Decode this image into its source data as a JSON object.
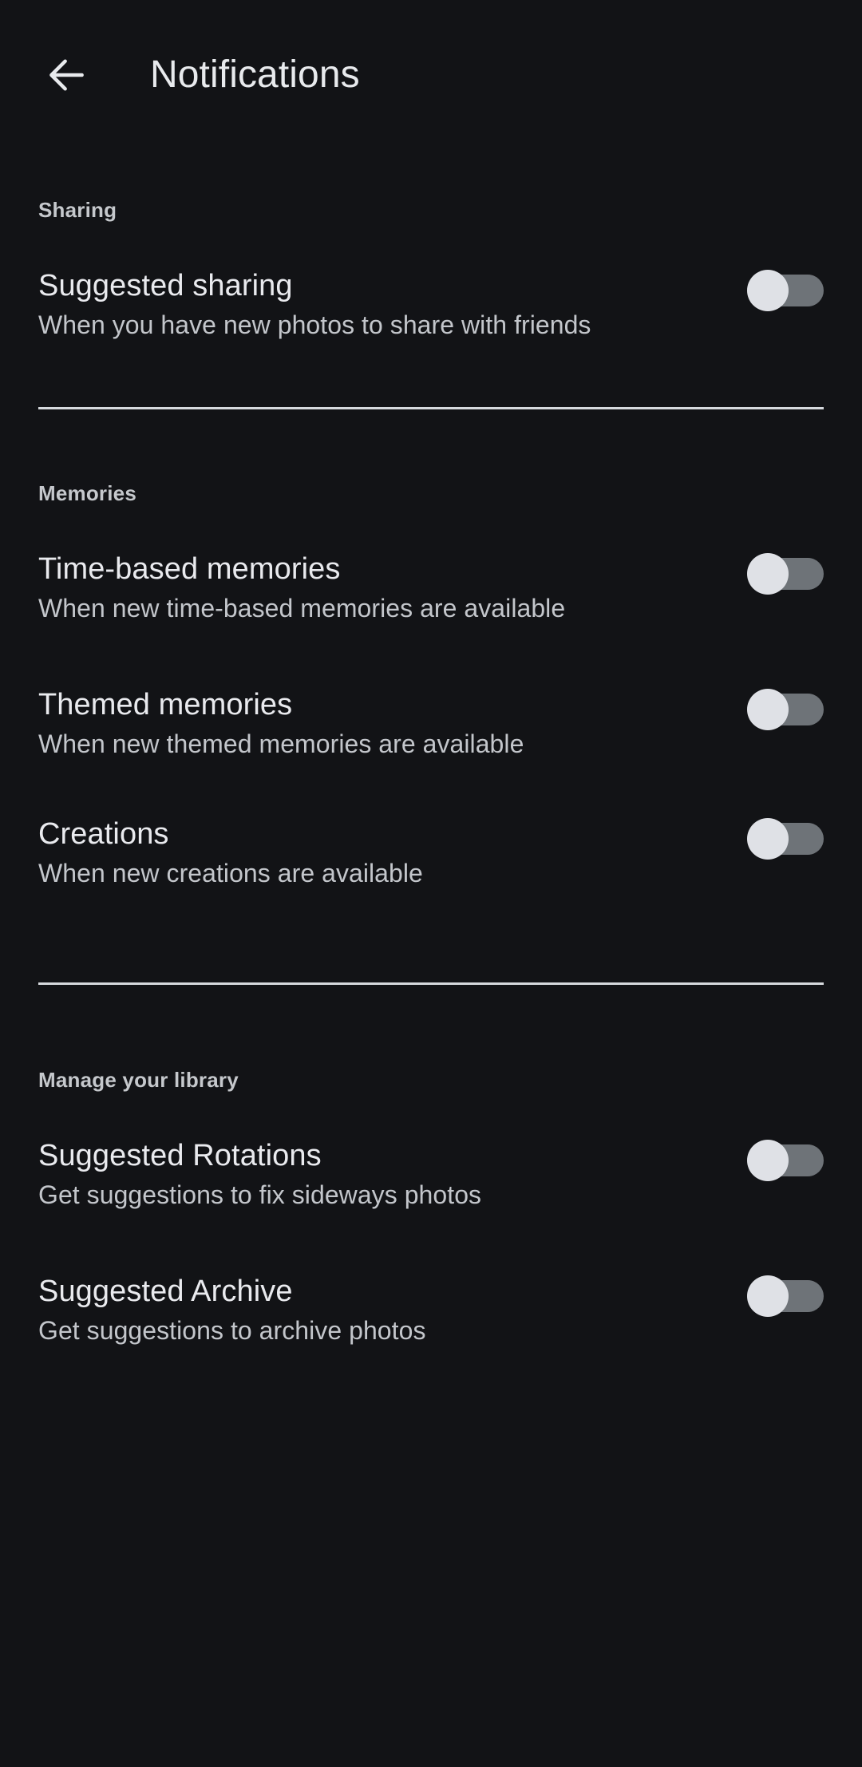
{
  "app": {
    "screen_title": "Notifications",
    "background_color": "#121316",
    "accent_text_color": "#e8eaed",
    "secondary_text_color": "#c3c6cb",
    "divider_color": "#d6d9dd",
    "toggle_track_color": "#6e7378",
    "toggle_thumb_color": "#dfe1e6"
  },
  "header": {
    "back_icon": "arrow-left-icon",
    "title": "Notifications"
  },
  "sections": [
    {
      "header": "Sharing",
      "items": [
        {
          "title": "Suggested sharing",
          "description": "When you have new photos to share with friends",
          "control": "toggle",
          "state": "off"
        }
      ]
    },
    {
      "header": "Memories",
      "items": [
        {
          "title": "Time-based memories",
          "description": "When new time-based memories are available",
          "control": "toggle",
          "state": "off"
        },
        {
          "title": "Themed memories",
          "description": "When new themed memories are available",
          "control": "toggle",
          "state": "off"
        },
        {
          "title": "Creations",
          "description": "When new creations are available",
          "control": "toggle",
          "state": "off"
        }
      ]
    },
    {
      "header": "Manage your library",
      "items": [
        {
          "title": "Suggested Rotations",
          "description": "Get suggestions to fix sideways photos",
          "control": "toggle",
          "state": "off"
        },
        {
          "title": "Suggested Archive",
          "description": "Get suggestions to archive photos",
          "control": "toggle",
          "state": "off"
        }
      ]
    }
  ]
}
